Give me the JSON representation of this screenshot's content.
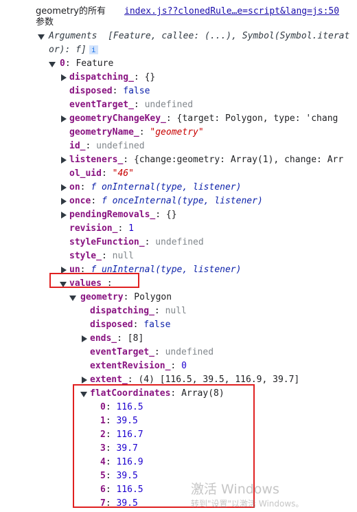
{
  "header": {
    "message_line1": "geometry的所有",
    "message_line2": "参数",
    "source_link": "index.js??clonedRule…e=script&lang=js:50"
  },
  "args": {
    "label": "Arguments",
    "preview_line1": "[Feature, callee: (...), Symbol(Symbol.iterat",
    "preview_line2": "or): f]",
    "info_icon": "i"
  },
  "feature": {
    "index": "0",
    "type": "Feature",
    "props": [
      {
        "key": "dispatching_",
        "val": "{}",
        "cls": "p",
        "tri": "right"
      },
      {
        "key": "disposed",
        "val": "false",
        "cls": "bool",
        "tri": ""
      },
      {
        "key": "eventTarget_",
        "val": "undefined",
        "cls": "undef",
        "tri": ""
      },
      {
        "key": "geometryChangeKey_",
        "val": "{target: Polygon, type: 'chang",
        "cls": "p",
        "tri": "right"
      },
      {
        "key": "geometryName_",
        "val": "\"geometry\"",
        "cls": "str",
        "tri": ""
      },
      {
        "key": "id_",
        "val": "undefined",
        "cls": "undef",
        "tri": ""
      },
      {
        "key": "listeners_",
        "val": "{change:geometry: Array(1), change: Arr",
        "cls": "p",
        "tri": "right"
      },
      {
        "key": "ol_uid",
        "val": "\"46\"",
        "cls": "str",
        "tri": ""
      },
      {
        "key": "on",
        "val": "f onInternal(type, listener)",
        "cls": "fn",
        "tri": "right"
      },
      {
        "key": "once",
        "val": "f onceInternal(type, listener)",
        "cls": "fn",
        "tri": "right"
      },
      {
        "key": "pendingRemovals_",
        "val": "{}",
        "cls": "p",
        "tri": "right"
      },
      {
        "key": "revision_",
        "val": "1",
        "cls": "num",
        "tri": ""
      },
      {
        "key": "styleFunction_",
        "val": "undefined",
        "cls": "undef",
        "tri": ""
      },
      {
        "key": "style_",
        "val": "null",
        "cls": "undef",
        "tri": ""
      },
      {
        "key": "un",
        "val": "f unInternal(type, listener)",
        "cls": "fn",
        "tri": "right"
      }
    ],
    "values_key": "values_"
  },
  "geometry": {
    "key": "geometry",
    "type": "Polygon",
    "props": [
      {
        "key": "dispatching_",
        "val": "null",
        "cls": "undef",
        "tri": ""
      },
      {
        "key": "disposed",
        "val": "false",
        "cls": "bool",
        "tri": ""
      },
      {
        "key": "ends_",
        "val": "[8]",
        "cls": "p",
        "tri": "right"
      },
      {
        "key": "eventTarget_",
        "val": "undefined",
        "cls": "undef",
        "tri": ""
      },
      {
        "key": "extentRevision_",
        "val": "0",
        "cls": "num",
        "tri": ""
      },
      {
        "key": "extent_",
        "val": "(4)  [116.5, 39.5, 116.9, 39.7]",
        "cls": "p",
        "tri": "right"
      }
    ]
  },
  "flatCoordinates": {
    "key": "flatCoordinates",
    "type": "Array(8)",
    "items": [
      {
        "idx": "0",
        "val": "116.5"
      },
      {
        "idx": "1",
        "val": "39.5"
      },
      {
        "idx": "2",
        "val": "116.7"
      },
      {
        "idx": "3",
        "val": "39.7"
      },
      {
        "idx": "4",
        "val": "116.9"
      },
      {
        "idx": "5",
        "val": "39.5"
      },
      {
        "idx": "6",
        "val": "116.5"
      },
      {
        "idx": "7",
        "val": "39.5"
      }
    ]
  },
  "watermark": {
    "line1": "激活 Windows",
    "line2": "转到\"设置\"以激活 Windows。"
  },
  "colors": {
    "annotation_box": "#e02020",
    "property_key": "#881280",
    "number": "#1c00cf",
    "string": "#c80000",
    "link": "#1a0dab"
  }
}
